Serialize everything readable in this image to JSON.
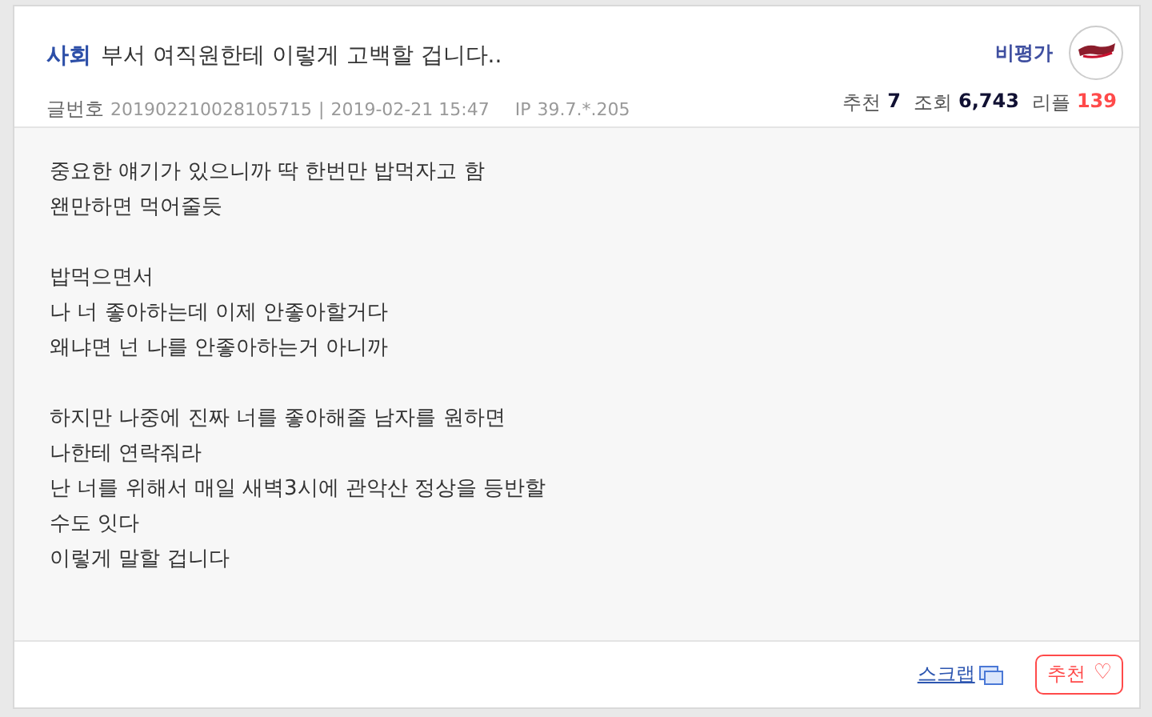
{
  "post": {
    "category": "사회",
    "title": "부서 여직원한테 이렇게 고백할 겁니다..",
    "author": "비평가",
    "meta": {
      "number_label": "글번호",
      "number": "201902210028105715",
      "separator": "|",
      "date": "2019-02-21 15:47",
      "ip_label": "IP",
      "ip": "39.7.*.205"
    },
    "stats": [
      {
        "label": "추천",
        "value": "7",
        "kind": "dark"
      },
      {
        "label": "조회",
        "value": "6,743",
        "kind": "dark"
      },
      {
        "label": "리플",
        "value": "139",
        "kind": "red"
      }
    ],
    "body": [
      [
        "중요한 얘기가 있으니까 딱 한번만 밥먹자고 함",
        "왠만하면 먹어줄듯"
      ],
      [
        "밥먹으면서",
        "나 너 좋아하는데 이제 안좋아할거다",
        "왜냐면 넌 나를 안좋아하는거 아니까"
      ],
      [
        "하지만 나중에 진짜 너를 좋아해줄 남자를 원하면",
        "나한테 연락줘라",
        "난 너를 위해서 매일 새벽3시에 관악산 정상을 등반할",
        "수도 잇다",
        "이렇게 말할 겁니다"
      ]
    ],
    "footer": {
      "scrap": "스크랩",
      "recommend": "추천",
      "heart": "♡"
    }
  }
}
